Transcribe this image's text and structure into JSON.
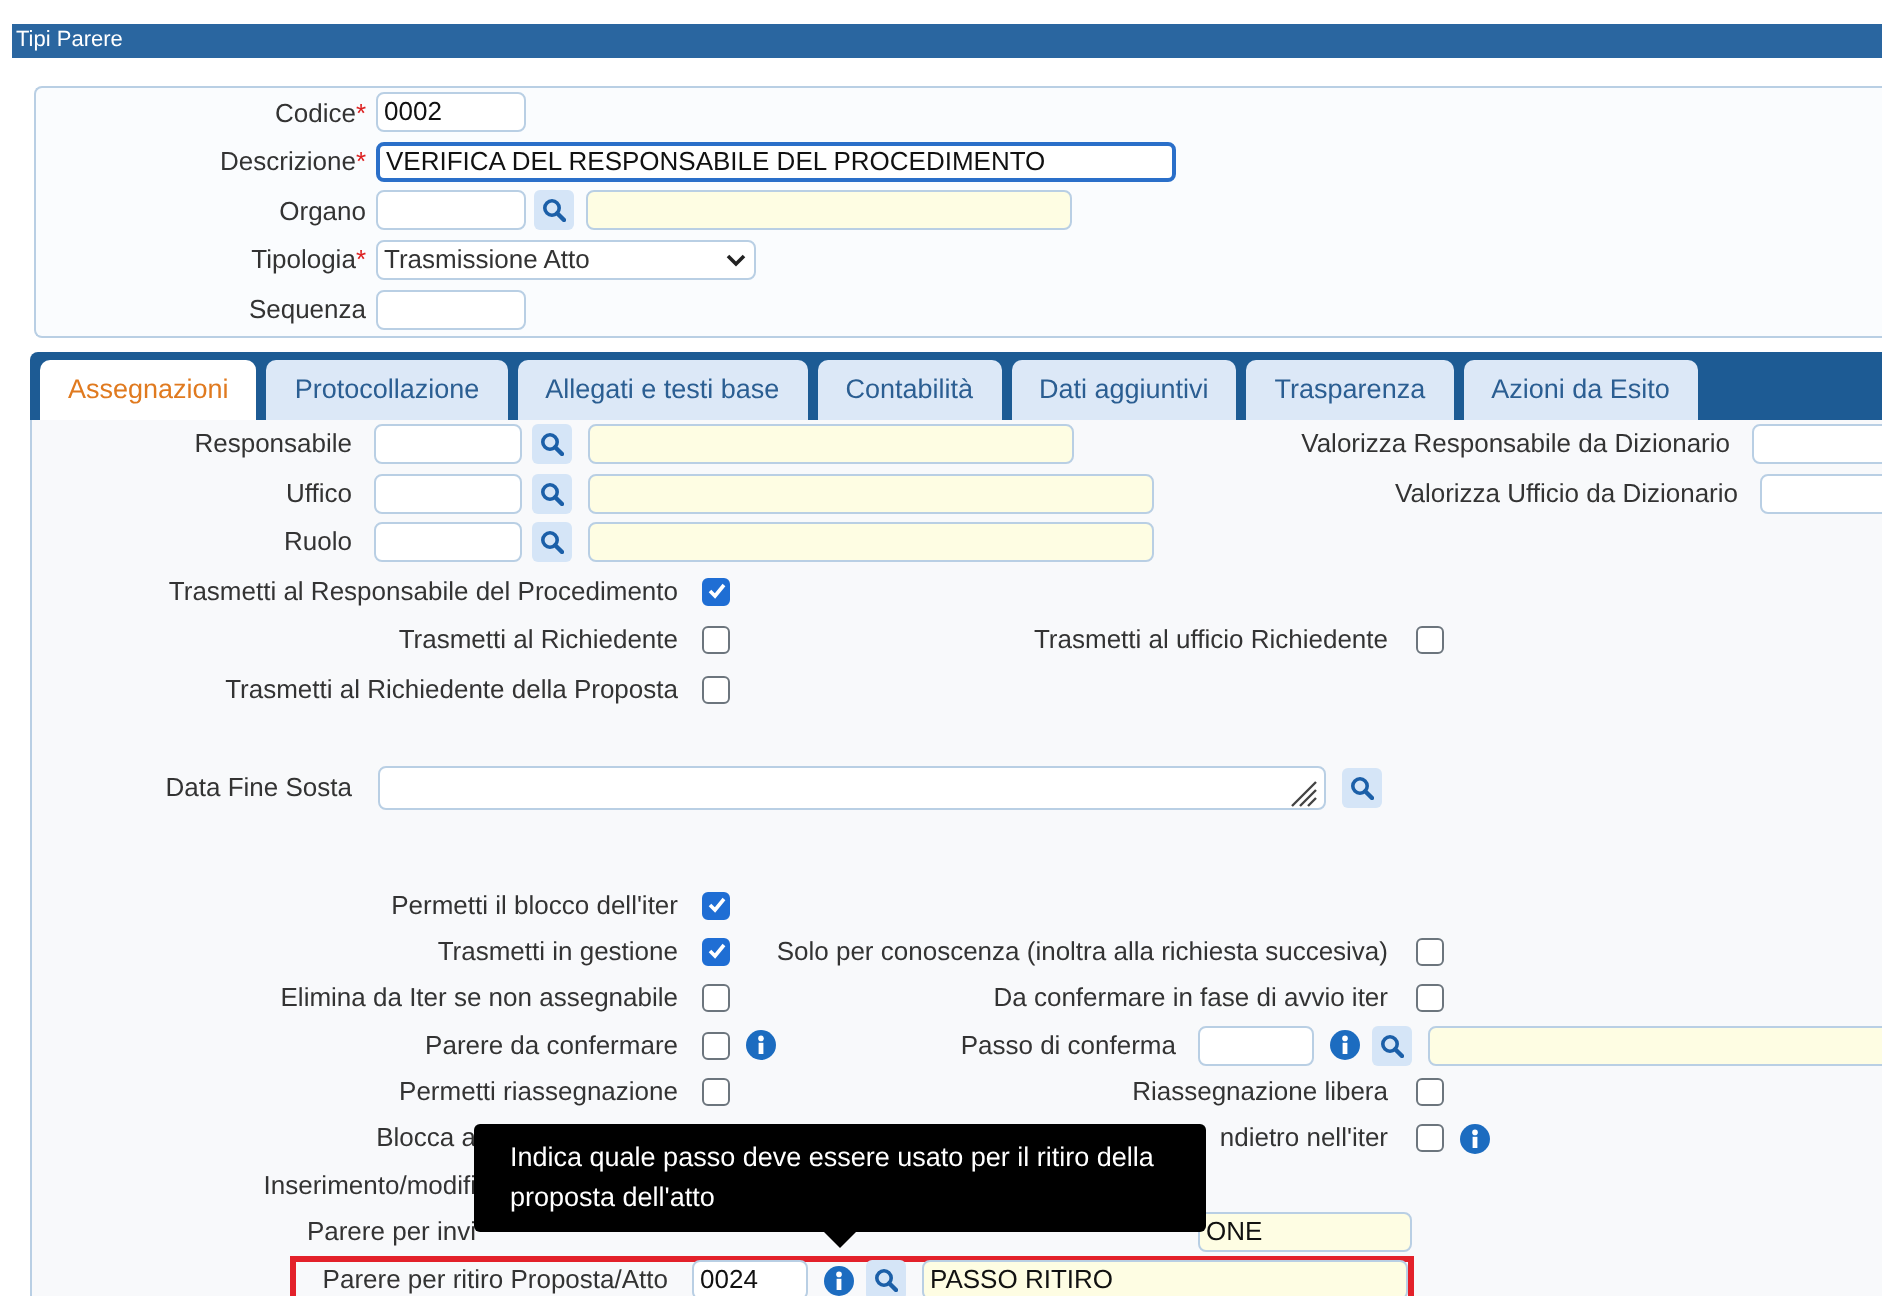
{
  "window": {
    "title": "Tipi Parere"
  },
  "header_fields": [
    {
      "label": "Codice",
      "required_mark": "*",
      "kind": "text",
      "value": "0002",
      "focused": false
    },
    {
      "label": "Descrizione",
      "required_mark": "*",
      "kind": "wide",
      "value": "VERIFICA DEL RESPONSABILE DEL PROCEDIMENTO",
      "focused": true
    },
    {
      "label": "Organo",
      "kind": "lookup",
      "focused": false
    },
    {
      "label": "Tipologia",
      "required_mark": "*",
      "kind": "select",
      "value": "Trasmissione Atto",
      "focused": false
    },
    {
      "label": "Sequenza",
      "kind": "text",
      "focused": false
    }
  ],
  "tabs": [
    {
      "label": "Assegnazioni",
      "selected": true
    },
    {
      "label": "Protocollazione",
      "selected": false
    },
    {
      "label": "Allegati e testi base",
      "selected": false
    },
    {
      "label": "Contabilità",
      "selected": false
    },
    {
      "label": "Dati aggiuntivi",
      "selected": false
    },
    {
      "label": "Trasparenza",
      "selected": false
    },
    {
      "label": "Azioni da Esito",
      "selected": false
    }
  ],
  "lookups": [
    {
      "label": "Responsabile",
      "side_label": "Valorizza Responsabile da Dizionario"
    },
    {
      "label": "Uffico",
      "side_label": "Valorizza Ufficio da Dizionario"
    },
    {
      "label": "Ruolo"
    }
  ],
  "transmit_rows": [
    [
      {
        "kind": "checkbox",
        "label": "Trasmetti al Responsabile del Procedimento",
        "checked": true
      }
    ],
    [
      {
        "kind": "checkbox",
        "label": "Trasmetti al Richiedente",
        "checked": false
      },
      {
        "kind": "checkbox",
        "label": "Trasmetti al ufficio Richiedente",
        "checked": false
      }
    ],
    [
      {
        "kind": "checkbox",
        "label": "Trasmetti al Richiedente della Proposta",
        "checked": false
      }
    ]
  ],
  "date_field": {
    "label": "Data Fine Sosta"
  },
  "option_rows": [
    [
      {
        "kind": "checkbox",
        "label": "Permetti il blocco dell'iter",
        "checked": true
      }
    ],
    [
      {
        "kind": "checkbox",
        "label": "Trasmetti in gestione",
        "checked": true
      },
      {
        "kind": "checkbox",
        "label": "Solo per conoscenza (inoltra alla richiesta succesiva)",
        "checked": false
      }
    ],
    [
      {
        "kind": "checkbox",
        "label": "Elimina da Iter se non assegnabile",
        "checked": false
      },
      {
        "kind": "checkbox",
        "label": "Da confermare in fase di avvio iter",
        "checked": false
      }
    ],
    [
      {
        "kind": "checkbox",
        "label": "Parere da confermare",
        "checked": false,
        "info": true
      },
      {
        "kind": "lookup",
        "label": "Passo di conferma",
        "info": true
      }
    ],
    [
      {
        "kind": "checkbox",
        "label": "Permetti riassegnazione",
        "checked": false
      },
      {
        "kind": "checkbox",
        "label": "Riassegnazione libera",
        "checked": false
      }
    ],
    [
      {
        "kind": "cut",
        "label": "Blocca a"
      },
      {
        "kind": "checkbox",
        "label": "ndietro nell'iter",
        "checked": false,
        "info": true
      }
    ],
    [
      {
        "kind": "cut",
        "label": "Inserimento/modifi"
      }
    ],
    [
      {
        "kind": "cut",
        "label": "Parere per invi"
      },
      {
        "kind": "tail",
        "value": "ONE"
      }
    ],
    [
      {
        "kind": "lookup",
        "label": "Parere per ritiro Proposta/Atto",
        "code": "0024",
        "description": "PASSO RITIRO",
        "info": true,
        "highlighted": true
      }
    ]
  ],
  "tooltip": {
    "text": "Indica quale passo deve essere usato per il ritiro della proposta dell'atto"
  }
}
